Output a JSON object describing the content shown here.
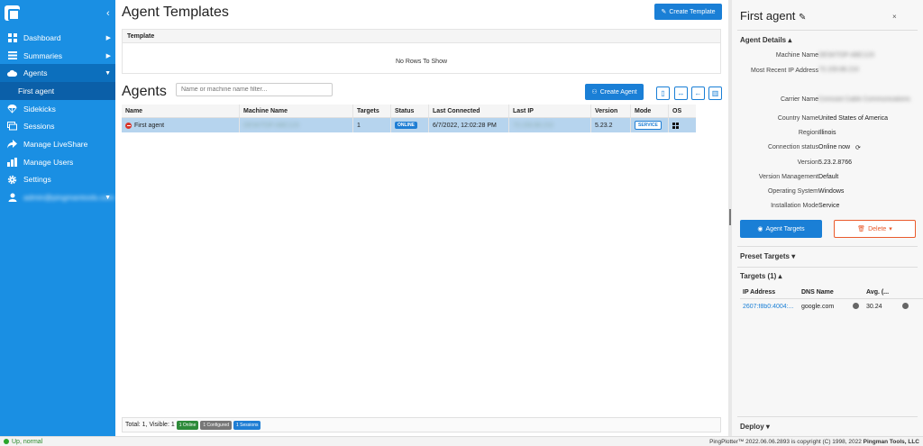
{
  "sidebar": {
    "items": [
      {
        "label": "Dashboard",
        "icon": "grid-icon",
        "arrow": "▶"
      },
      {
        "label": "Summaries",
        "icon": "list-icon",
        "arrow": "▶"
      },
      {
        "label": "Agents",
        "icon": "cloud-icon",
        "arrow": "▼"
      },
      {
        "label": "First agent",
        "icon": "",
        "arrow": ""
      },
      {
        "label": "Sidekicks",
        "icon": "parachute-icon",
        "arrow": ""
      },
      {
        "label": "Sessions",
        "icon": "sessions-icon",
        "arrow": ""
      },
      {
        "label": "Manage LiveShare",
        "icon": "share-icon",
        "arrow": ""
      },
      {
        "label": "Manage Users",
        "icon": "users-icon",
        "arrow": ""
      },
      {
        "label": "Settings",
        "icon": "gear-icon",
        "arrow": ""
      },
      {
        "label": "admin@pingmantools.com",
        "icon": "user-icon",
        "arrow": "▼"
      }
    ]
  },
  "templates": {
    "title": "Agent Templates",
    "create_label": "Create Template",
    "column": "Template",
    "empty": "No Rows To Show"
  },
  "agents": {
    "title": "Agents",
    "filter_placeholder": "Name or machine name filter...",
    "create_label": "Create Agent",
    "columns": [
      "Name",
      "Machine Name",
      "Targets",
      "Status",
      "Last Connected",
      "Last IP",
      "Version",
      "Mode",
      "OS"
    ],
    "rows": [
      {
        "name": "First agent",
        "machine": "DESKTOP-ABC123",
        "targets": "1",
        "status": "ONLINE",
        "last_connected": "6/7/2022, 12:02:28 PM",
        "last_ip": "73.159.88.210",
        "version": "5.23.2",
        "mode": "SERVICE",
        "os": "windows-icon"
      }
    ],
    "footer": {
      "text": "Total: 1, Visible: 1",
      "online": "1 Online",
      "configured": "1 Configured",
      "sessions": "1 Sessions"
    }
  },
  "panel": {
    "title": "First agent",
    "details_header": "Agent Details ▴",
    "details": [
      {
        "key": "Machine Name",
        "value": "DESKTOP-ABC123",
        "blur": true
      },
      {
        "key": "Most Recent IP Address",
        "value": "73.159.88.210",
        "blur": true
      },
      {
        "key": "Carrier Name",
        "value": "Comcast Cable Communications",
        "blur": true
      },
      {
        "key": "Country Name",
        "value": "United States of America",
        "blur": false
      },
      {
        "key": "Region",
        "value": "Illinois",
        "blur": false
      },
      {
        "key": "Connection status",
        "value": "Online now",
        "blur": false
      },
      {
        "key": "Version",
        "value": "5.23.2.8766",
        "blur": false
      },
      {
        "key": "Version Management",
        "value": "Default",
        "blur": false
      },
      {
        "key": "Operating System",
        "value": "Windows",
        "blur": false
      },
      {
        "key": "Installation Mode",
        "value": "Service",
        "blur": false
      }
    ],
    "targets_button": "Agent Targets",
    "delete_button": "Delete",
    "preset_header": "Preset Targets ▾",
    "targets_header": "Targets (1) ▴",
    "target_columns": [
      "IP Address",
      "DNS Name",
      "Avg. (..."
    ],
    "targets": [
      {
        "ip": "2607:f8b0:4004:...",
        "dns": "google.com",
        "avg": "30.24"
      }
    ],
    "deploy_header": "Deploy ▾"
  },
  "statusbar": {
    "status": "Up, normal",
    "copyright_prefix": "PingPlotter™ 2022.06.06.2893 is copyright (C) 1998, 2022 ",
    "copyright_company": "Pingman Tools, LLC"
  }
}
